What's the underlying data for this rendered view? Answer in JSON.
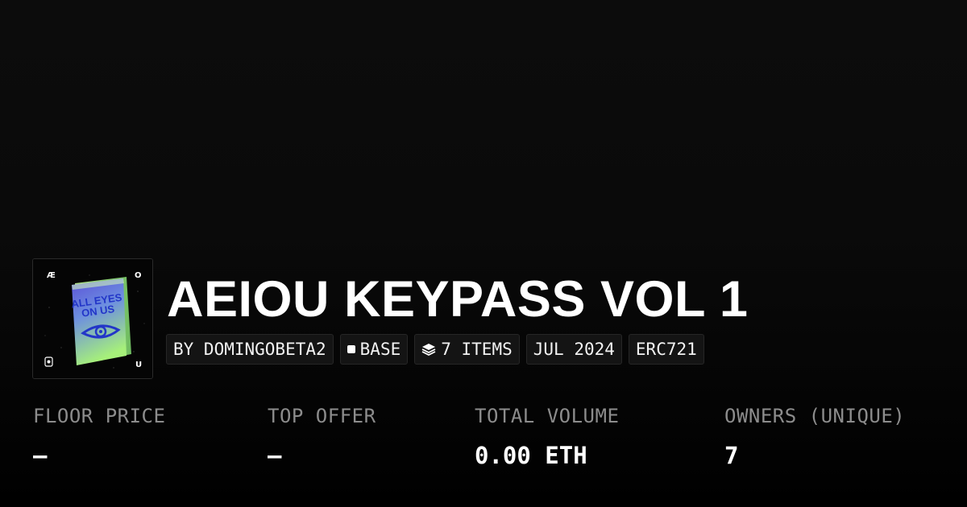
{
  "collection": {
    "title": "AEIOU KEYPASS VOL 1",
    "thumbnail": {
      "corner_top_left": "Æ",
      "corner_top_right": "O",
      "corner_bottom_right": "U",
      "card_text_line1": "ALL EYES",
      "card_text_line2": "ON US"
    }
  },
  "tags": {
    "creator": "BY DOMINGOBETA2",
    "chain": "BASE",
    "chain_icon": "square-icon",
    "items": "7 ITEMS",
    "items_icon": "layers-icon",
    "date": "JUL 2024",
    "standard": "ERC721"
  },
  "stats": {
    "floor_price": {
      "label": "FLOOR PRICE",
      "value": "–"
    },
    "top_offer": {
      "label": "TOP OFFER",
      "value": "–"
    },
    "total_volume": {
      "label": "TOTAL VOLUME",
      "value": "0.00 ETH"
    },
    "owners": {
      "label": "OWNERS (UNIQUE)",
      "value": "7"
    }
  },
  "colors": {
    "background": "#000000",
    "tag_background": "#141414",
    "label_gray": "#8c8c8c",
    "text": "#ffffff",
    "card_green": "#a6f07a",
    "card_blue": "#2a3fd0"
  }
}
